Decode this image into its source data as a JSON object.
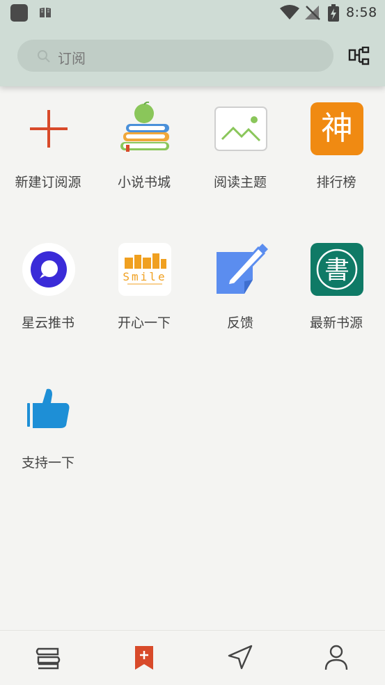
{
  "status_bar": {
    "time": "8:58"
  },
  "search": {
    "placeholder": "订阅"
  },
  "tiles": [
    {
      "label": "新建订阅源",
      "icon": "plus-icon"
    },
    {
      "label": "小说书城",
      "icon": "books-apple-icon"
    },
    {
      "label": "阅读主题",
      "icon": "image-icon"
    },
    {
      "label": "排行榜",
      "icon": "shen-logo-icon",
      "logo_char": "神"
    },
    {
      "label": "星云推书",
      "icon": "nebula-icon"
    },
    {
      "label": "开心一下",
      "icon": "smile-logo-icon",
      "logo_text": "Smile"
    },
    {
      "label": "反馈",
      "icon": "feedback-pen-icon"
    },
    {
      "label": "最新书源",
      "icon": "book-source-logo-icon",
      "logo_char": "書"
    },
    {
      "label": "支持一下",
      "icon": "thumbs-up-icon"
    }
  ],
  "bottom_nav": [
    {
      "name": "bookshelf",
      "icon": "bookshelf-icon"
    },
    {
      "name": "subscription",
      "icon": "bookmark-plus-icon",
      "active": true
    },
    {
      "name": "discover",
      "icon": "navigation-arrow-icon"
    },
    {
      "name": "profile",
      "icon": "user-icon"
    }
  ],
  "colors": {
    "accent": "#d84a2a",
    "header": "#cfdcd5",
    "background": "#f4f4f2"
  }
}
